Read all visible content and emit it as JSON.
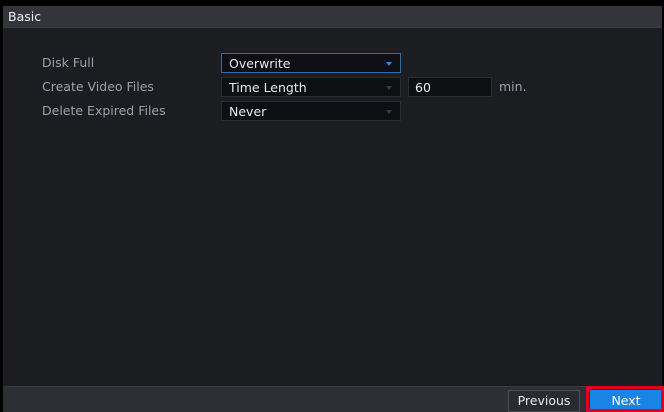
{
  "window": {
    "title": "Basic"
  },
  "settings": {
    "disk_full": {
      "label": "Disk Full",
      "value": "Overwrite"
    },
    "create_video_files": {
      "label": "Create Video Files",
      "mode": "Time Length",
      "amount": "60",
      "unit": "min."
    },
    "delete_expired_files": {
      "label": "Delete Expired Files",
      "value": "Never"
    }
  },
  "footer": {
    "previous_label": "Previous",
    "next_label": "Next"
  },
  "colors": {
    "accent": "#1a84e6",
    "highlight": "#e3001b",
    "panel_background": "#1c1d21",
    "titlebar_background": "#34353b"
  },
  "icons": [
    "dropdown-arrow-icon"
  ]
}
